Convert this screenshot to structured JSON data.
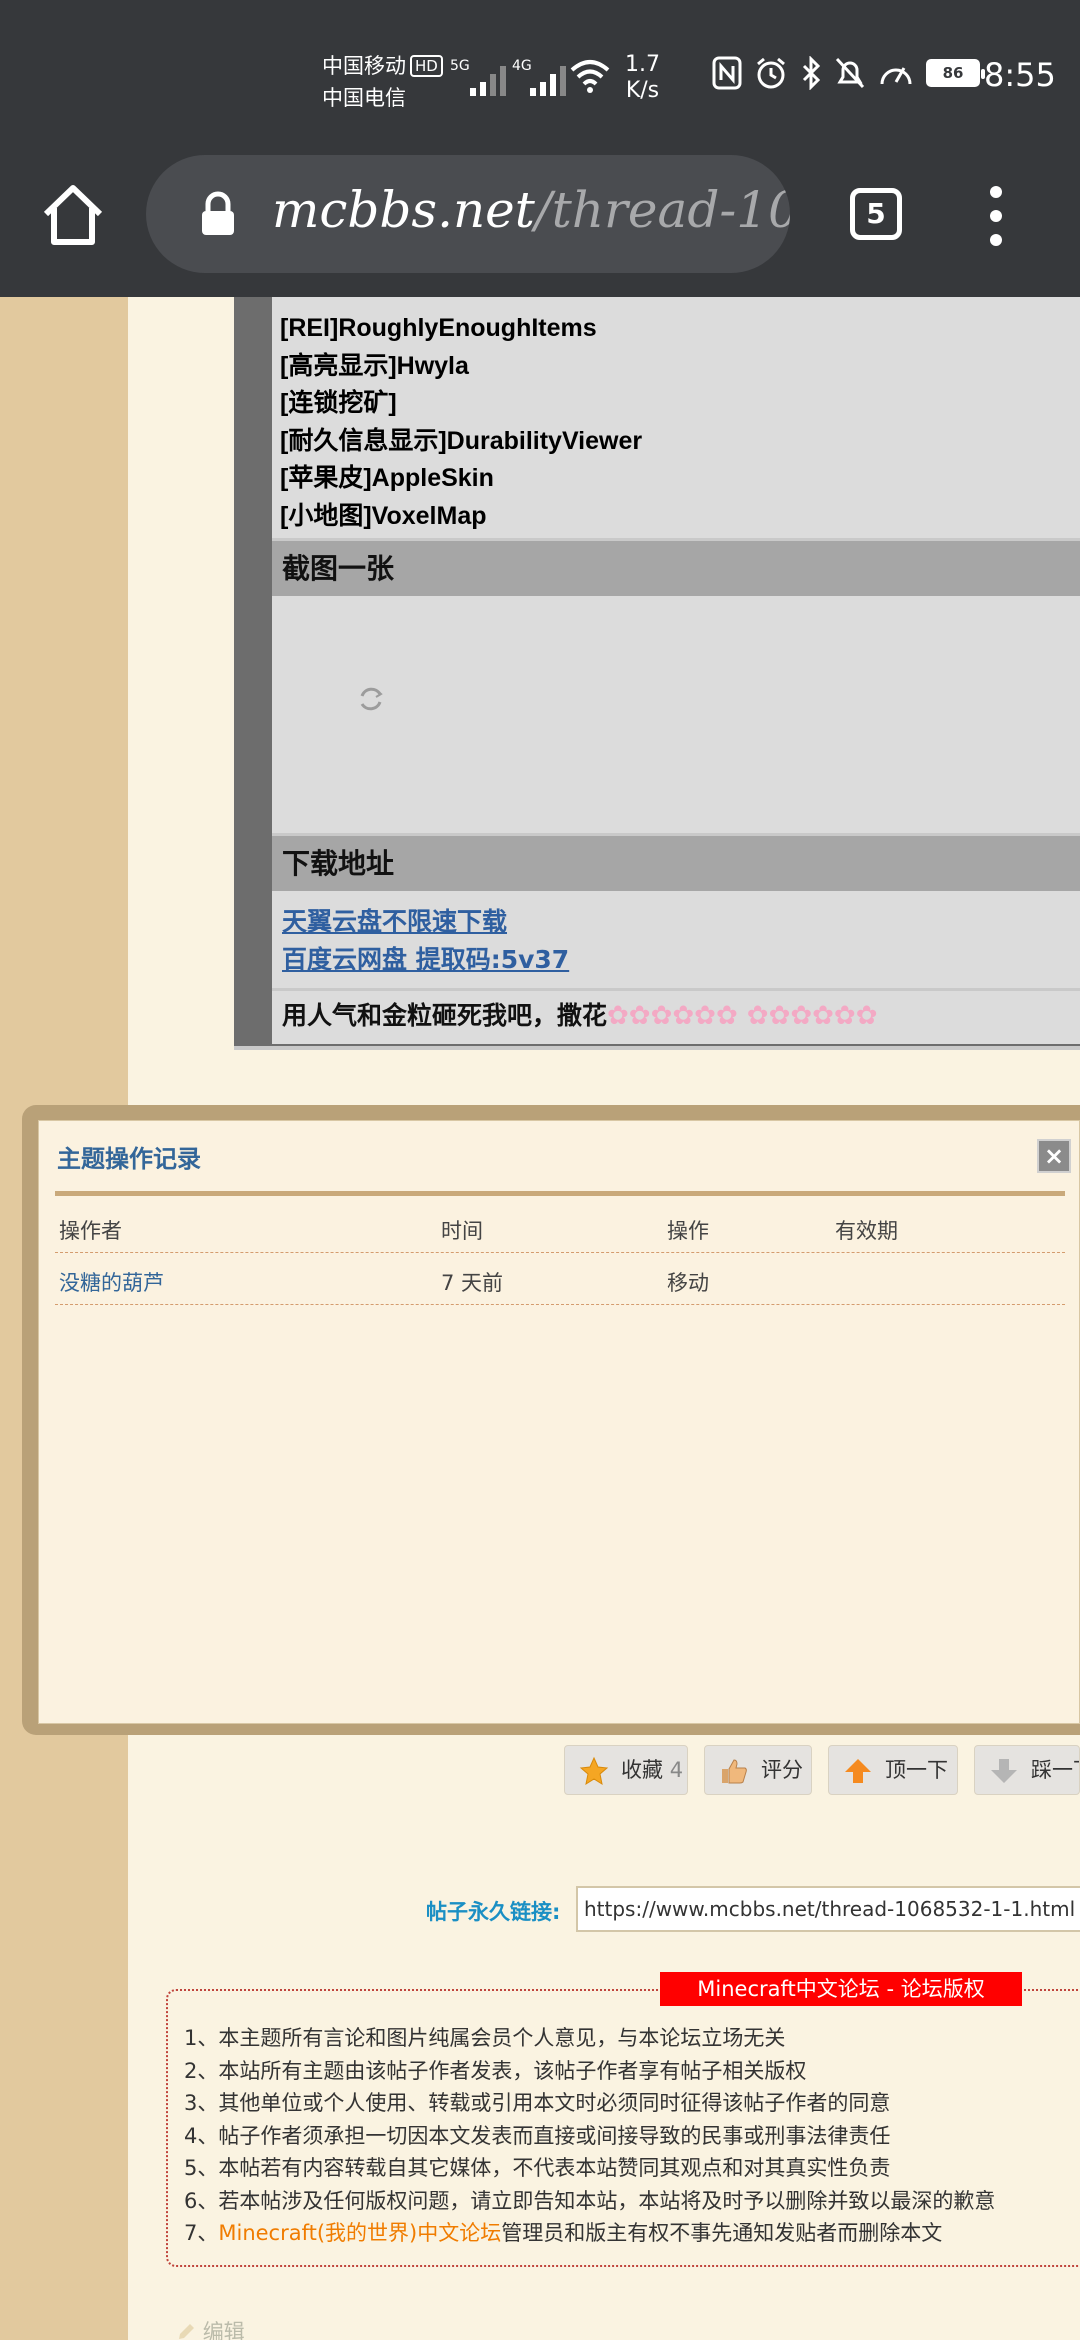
{
  "status_bar": {
    "carrier_1": "中国移动",
    "carrier_1_badge": "HD",
    "carrier_2": "中国电信",
    "sig_1": "5G",
    "sig_2": "4G",
    "speed_value": "1.7",
    "speed_unit": "K/s",
    "battery": "86",
    "time": "8:55"
  },
  "browser": {
    "url_host": "mcbbs.net",
    "url_path": "/thread-10",
    "tab_count": "5"
  },
  "post": {
    "mods": [
      "[REI]RoughlyEnoughItems",
      "[高亮显示]Hwyla",
      "[连锁挖矿]",
      "[耐久信息显示]DurabilityViewer",
      "[苹果皮]AppleSkin",
      "[小地图]VoxelMap"
    ],
    "screenshot_heading": "截图一张",
    "download_heading": "下载地址",
    "download_links": [
      "天翼云盘不限速下载",
      "百度云网盘 提取码:5v37"
    ],
    "sign_text": "用人气和金粒砸死我吧，撒花",
    "flowers": "✿✿✿✿✿✿ ✿✿✿✿✿✿"
  },
  "log_popup": {
    "title": "主题操作记录",
    "close": "×",
    "columns": [
      "操作者",
      "时间",
      "操作",
      "有效期"
    ],
    "rows": [
      {
        "operator": "没糖的葫芦",
        "time": "7 天前",
        "action": "移动",
        "validity": ""
      }
    ]
  },
  "actions": {
    "favorite_label": "收藏",
    "favorite_count": "4",
    "rate_label": "评分",
    "up_label": "顶一下",
    "down_label": "踩一下"
  },
  "permalink": {
    "label": "帖子永久链接:",
    "value": "https://www.mcbbs.net/thread-1068532-1-1.html"
  },
  "copyright": {
    "tag": "Minecraft中文论坛 - 论坛版权",
    "lines": [
      "1、本主题所有言论和图片纯属会员个人意见，与本论坛立场无关",
      "2、本站所有主题由该帖子作者发表，该帖子作者享有帖子相关版权",
      "3、其他单位或个人使用、转载或引用本文时必须同时征得该帖子作者的同意",
      "4、帖子作者须承担一切因本文发表而直接或间接导致的民事或刑事法律责任",
      "5、本帖若有内容转载自其它媒体，不代表本站赞同其观点和对其真实性负责",
      "6、若本帖涉及任何版权问题，请立即告知本站，本站将及时予以删除并致以最深的歉意"
    ],
    "line7_prefix": "7、",
    "line7_link": "Minecraft(我的世界)中文论坛",
    "line7_suffix": "管理员和版主有权不事先通知发贴者而删除本文"
  },
  "footer": {
    "edit_label": "编辑"
  },
  "colors": {
    "topbar": "#36383b",
    "link_blue": "#336699",
    "copyright_red": "#ff0000",
    "forum_bg": "#faf3e1"
  }
}
